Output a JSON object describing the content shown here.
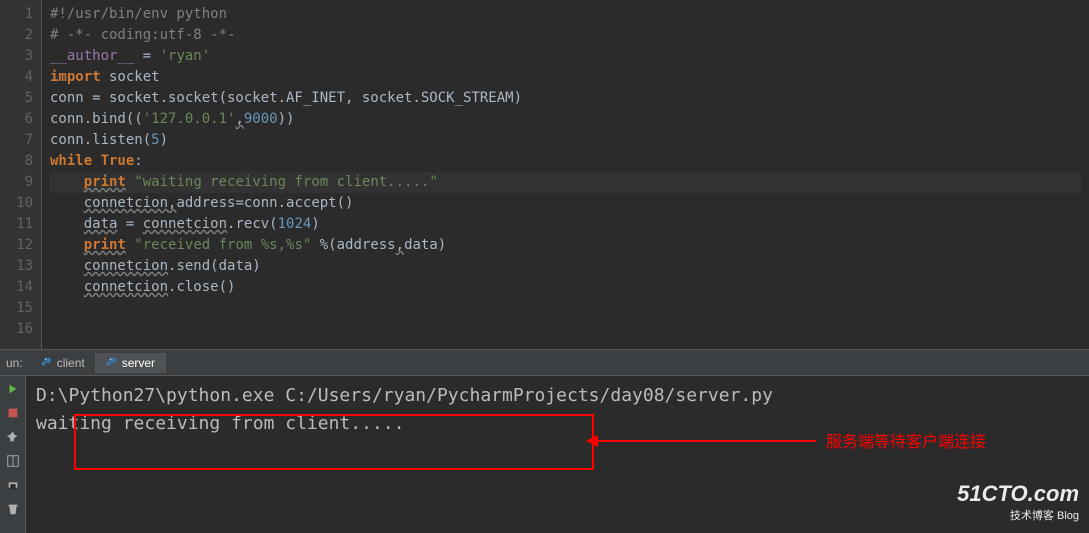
{
  "editor": {
    "lines": [
      {
        "n": "1",
        "tokens": [
          {
            "t": "#!/usr/bin/env python",
            "c": "comment"
          }
        ]
      },
      {
        "n": "2",
        "tokens": [
          {
            "t": "# -*- coding:utf-8 -*-",
            "c": "comment"
          }
        ]
      },
      {
        "n": "3",
        "tokens": [
          {
            "t": "__author__",
            "c": "special"
          },
          {
            "t": " = ",
            "c": "ident"
          },
          {
            "t": "'ryan'",
            "c": "string"
          }
        ]
      },
      {
        "n": "4",
        "tokens": [
          {
            "t": "import",
            "c": "keyword"
          },
          {
            "t": " socket",
            "c": "ident"
          }
        ]
      },
      {
        "n": "5",
        "tokens": [
          {
            "t": "conn = socket.socket(socket.AF_INET, socket.SOCK_STREAM)",
            "c": "ident"
          }
        ]
      },
      {
        "n": "6",
        "tokens": [
          {
            "t": "conn.bind((",
            "c": "ident"
          },
          {
            "t": "'127.0.0.1'",
            "c": "string"
          },
          {
            "t": ",",
            "c": "ident wavy"
          },
          {
            "t": "9000",
            "c": "number"
          },
          {
            "t": "))",
            "c": "ident"
          }
        ]
      },
      {
        "n": "7",
        "tokens": [
          {
            "t": "conn.listen(",
            "c": "ident"
          },
          {
            "t": "5",
            "c": "number"
          },
          {
            "t": ")",
            "c": "ident"
          }
        ]
      },
      {
        "n": "8",
        "tokens": [
          {
            "t": "while ",
            "c": "keyword"
          },
          {
            "t": "True",
            "c": "keyword"
          },
          {
            "t": ":",
            "c": "ident"
          }
        ]
      },
      {
        "n": "9",
        "tokens": [
          {
            "t": "    ",
            "c": "ident"
          },
          {
            "t": "print",
            "c": "keyword wavy"
          },
          {
            "t": " ",
            "c": "ident"
          },
          {
            "t": "\"waiting receiving from client.....\"",
            "c": "string"
          }
        ]
      },
      {
        "n": "10",
        "tokens": [
          {
            "t": "    ",
            "c": "ident"
          },
          {
            "t": "connetcion",
            "c": "ident wavy"
          },
          {
            "t": ",",
            "c": "ident wavy"
          },
          {
            "t": "address=conn.accept()",
            "c": "ident"
          }
        ]
      },
      {
        "n": "11",
        "tokens": [
          {
            "t": "    ",
            "c": "ident"
          },
          {
            "t": "data",
            "c": "ident wavy"
          },
          {
            "t": " = ",
            "c": "ident"
          },
          {
            "t": "connetcion",
            "c": "ident wavy"
          },
          {
            "t": ".recv(",
            "c": "ident"
          },
          {
            "t": "1024",
            "c": "number"
          },
          {
            "t": ")",
            "c": "ident"
          }
        ]
      },
      {
        "n": "12",
        "tokens": [
          {
            "t": "    ",
            "c": "ident"
          },
          {
            "t": "print",
            "c": "keyword wavy"
          },
          {
            "t": " ",
            "c": "ident"
          },
          {
            "t": "\"received from %s,%s\"",
            "c": "string"
          },
          {
            "t": " %(address",
            "c": "ident"
          },
          {
            "t": ",",
            "c": "ident wavy"
          },
          {
            "t": "data)",
            "c": "ident"
          }
        ]
      },
      {
        "n": "13",
        "tokens": [
          {
            "t": "    ",
            "c": "ident"
          },
          {
            "t": "connetcion",
            "c": "ident wavy"
          },
          {
            "t": ".send(data)",
            "c": "ident"
          }
        ]
      },
      {
        "n": "14",
        "tokens": [
          {
            "t": "    ",
            "c": "ident"
          },
          {
            "t": "connetcion",
            "c": "ident wavy"
          },
          {
            "t": ".close()",
            "c": "ident"
          }
        ]
      },
      {
        "n": "15",
        "tokens": []
      },
      {
        "n": "16",
        "tokens": []
      }
    ]
  },
  "run": {
    "label": "un:",
    "tabs": [
      {
        "label": "client",
        "active": false
      },
      {
        "label": "server",
        "active": true
      }
    ]
  },
  "console": {
    "cmd": "D:\\Python27\\python.exe C:/Users/ryan/PycharmProjects/day08/server.py",
    "out1": "waiting receiving from client....."
  },
  "annotation": "服务端等待客户端连接",
  "watermark": {
    "main": "51CTO.com",
    "sub": "技术博客  Blog"
  }
}
